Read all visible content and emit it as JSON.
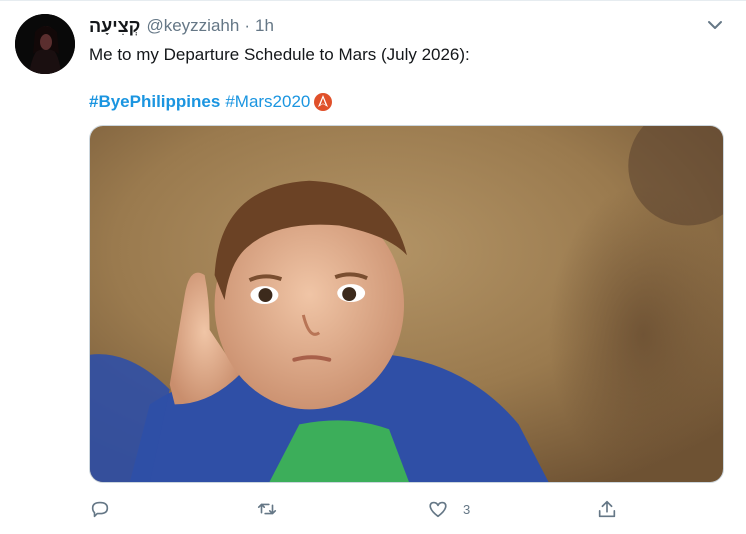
{
  "tweet": {
    "display_name": "קְצִיעָה",
    "handle": "@keyzziahh",
    "separator": "·",
    "time": "1h",
    "text": "Me to my Departure Schedule to Mars (July 2026):",
    "hashtags": [
      "#ByePhilippines",
      "#Mars2020"
    ],
    "hashtag_emoji": "mars-2020-icon",
    "media_description_icon": "meme-photo",
    "actions": {
      "reply_count": "",
      "retweet_count": "",
      "like_count": "3",
      "share_count": ""
    }
  },
  "colors": {
    "link": "#1b95e0",
    "muted": "#657786",
    "text": "#14171a",
    "emoji_accent": "#e0502a"
  }
}
